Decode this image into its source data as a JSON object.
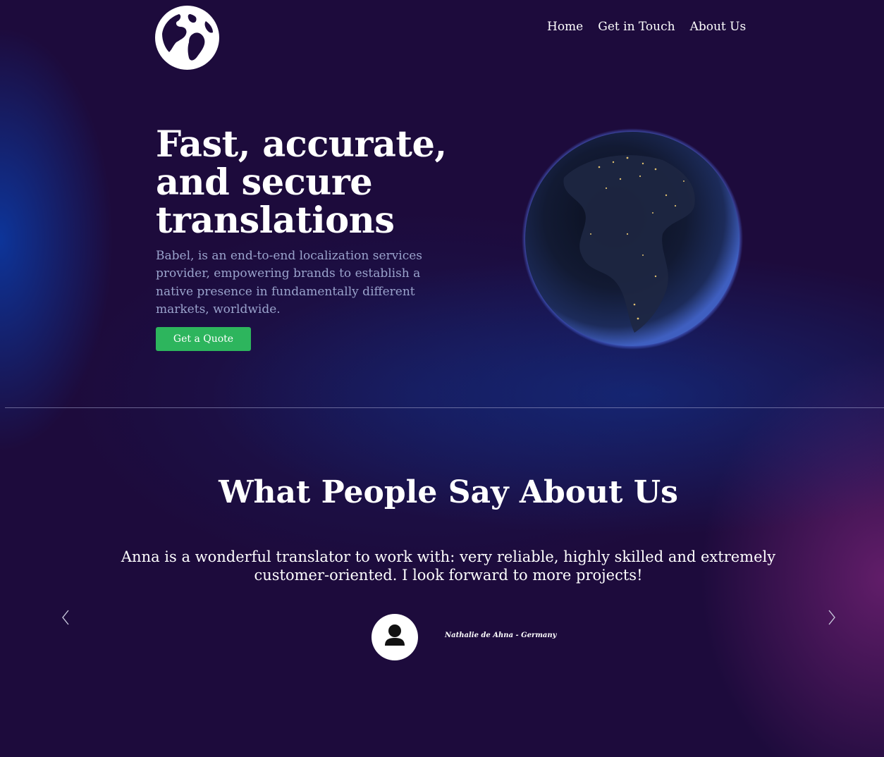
{
  "header": {
    "logo_icon": "globe-icon",
    "nav": [
      {
        "label": "Home"
      },
      {
        "label": "Get in Touch"
      },
      {
        "label": "About Us"
      }
    ]
  },
  "hero": {
    "title": "Fast, accurate, and secure translations",
    "subtitle": "Babel, is an end-to-end localization services provider, empowering brands to establish a native presence in fundamentally different markets, worldwide.",
    "cta_label": "Get a Quote",
    "image": "earth-at-night-globe"
  },
  "testimonials": {
    "title": "What People Say About Us",
    "quote": "Anna is a wonderful translator to work with: very reliable, highly skilled and extremely customer-oriented. I look forward to more projects!",
    "author": "Nathalie de Ahna - Germany",
    "prev_icon": "chevron-left-icon",
    "next_icon": "chevron-right-icon",
    "avatar_icon": "user-icon"
  },
  "colors": {
    "background": "#1d0b3c",
    "accent_button": "#2db55d",
    "subtitle_text": "#9aa3cc",
    "text": "#ffffff"
  }
}
